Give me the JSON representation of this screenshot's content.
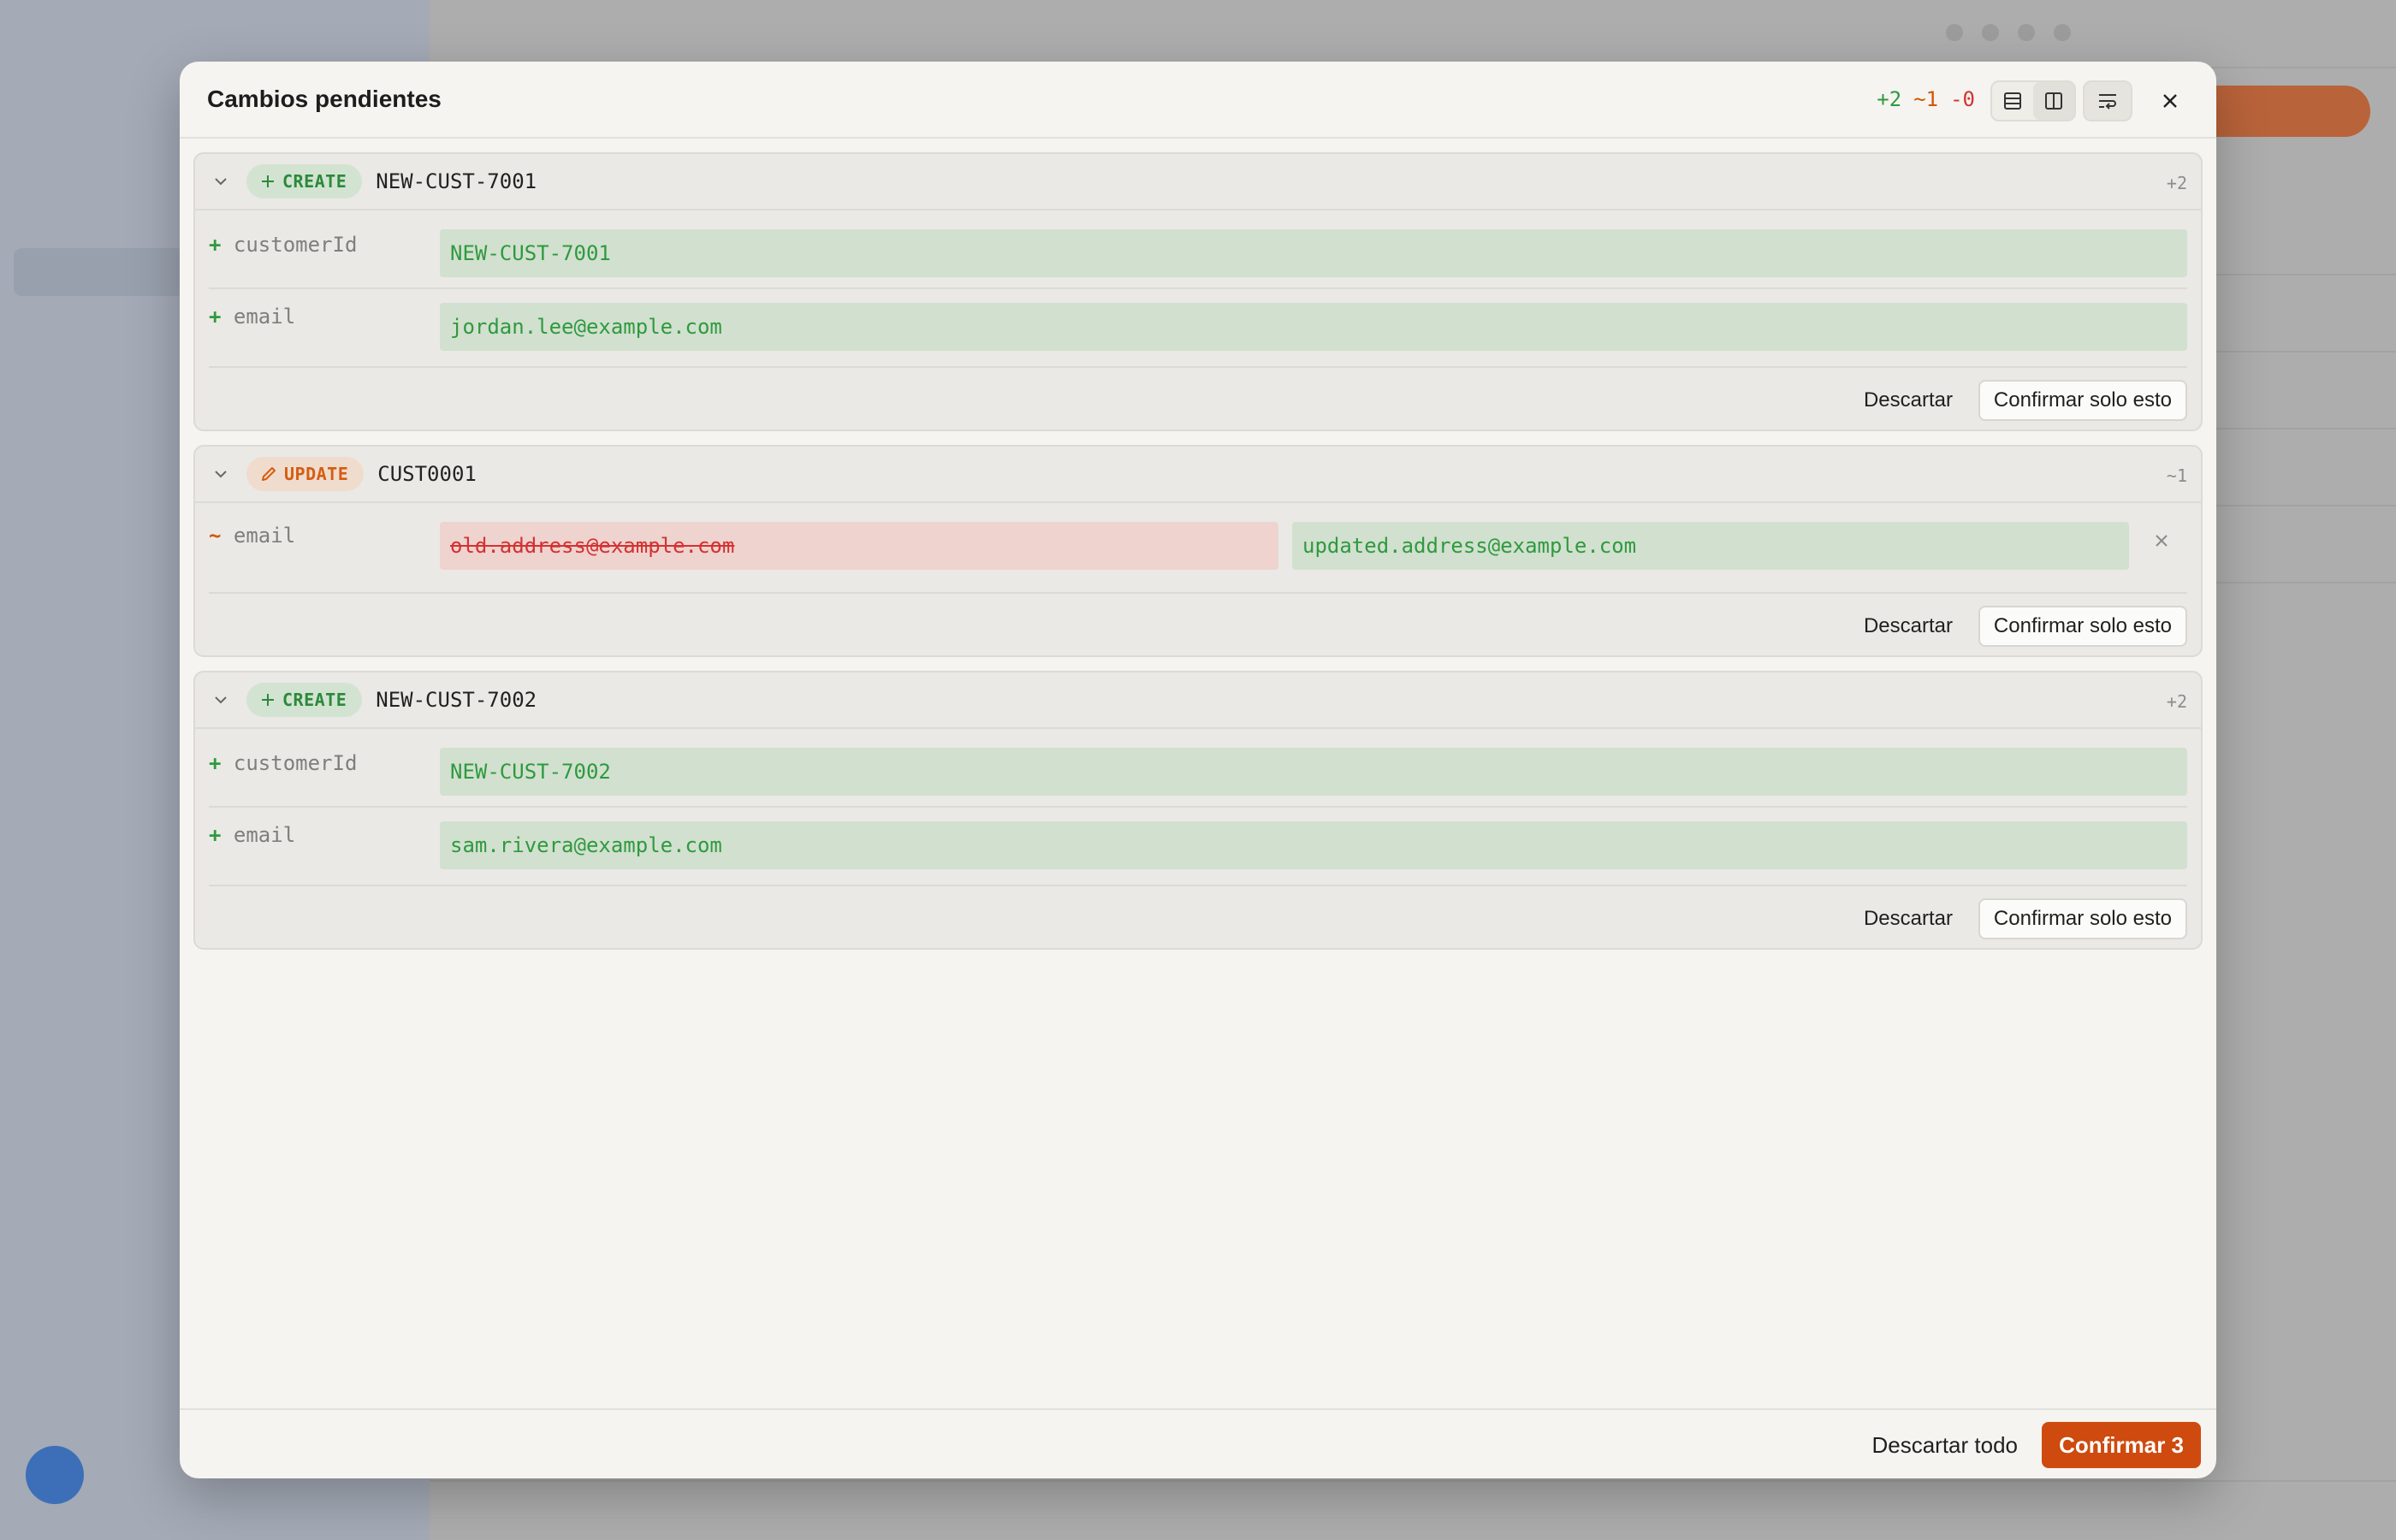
{
  "modal": {
    "title": "Cambios pendientes",
    "counts": {
      "added": "+2",
      "modified": "~1",
      "deleted": "-0"
    },
    "discard_all_label": "Descartar todo",
    "confirm_all_label": "Confirmar 3"
  },
  "changes": [
    {
      "op": "CREATE",
      "record_id": "NEW-CUST-7001",
      "count": "+2",
      "fields": [
        {
          "marker": "+",
          "name": "customerId",
          "new_value": "NEW-CUST-7001"
        },
        {
          "marker": "+",
          "name": "email",
          "new_value": "jordan.lee@example.com"
        }
      ],
      "discard_label": "Descartar",
      "confirm_label": "Confirmar solo esto"
    },
    {
      "op": "UPDATE",
      "record_id": "CUST0001",
      "count": "~1",
      "fields": [
        {
          "marker": "~",
          "name": "email",
          "old_value": "old.address@example.com",
          "new_value": "updated.address@example.com"
        }
      ],
      "discard_label": "Descartar",
      "confirm_label": "Confirmar solo esto"
    },
    {
      "op": "CREATE",
      "record_id": "NEW-CUST-7002",
      "count": "+2",
      "fields": [
        {
          "marker": "+",
          "name": "customerId",
          "new_value": "NEW-CUST-7002"
        },
        {
          "marker": "+",
          "name": "email",
          "new_value": "sam.rivera@example.com"
        }
      ],
      "discard_label": "Descartar",
      "confirm_label": "Confirmar solo esto"
    }
  ],
  "colors": {
    "accent": "#cf4a0e",
    "added": "#2e9a3e",
    "modified": "#d45500",
    "deleted": "#d43232"
  },
  "icons": {
    "header": [
      "unified-view-icon",
      "split-view-icon",
      "wrap-lines-icon",
      "close-icon"
    ],
    "card": [
      "chevron-down-icon",
      "plus-icon",
      "pencil-icon",
      "revert-x-icon"
    ]
  }
}
